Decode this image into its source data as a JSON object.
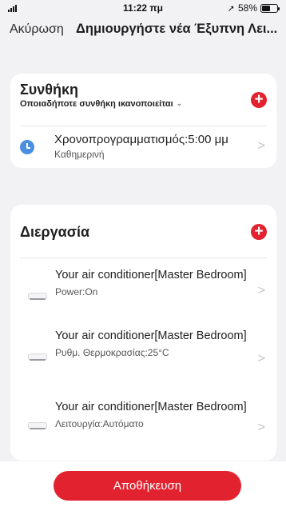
{
  "status_bar": {
    "time": "11:22 πμ",
    "battery_text": "58%",
    "battery_level": 0.58
  },
  "nav": {
    "cancel_label": "Ακύρωση",
    "title": "Δημιουργήστε νέα Έξυπνη Λει..."
  },
  "condition": {
    "title": "Συνθήκη",
    "subtitle": "Οποιαδήποτε συνθήκη ικανοποιείται",
    "items": [
      {
        "icon": "clock-icon",
        "label": "Χρονοπρογραμματισμός:5:00 μμ",
        "sub": "Καθημερινή"
      }
    ]
  },
  "task": {
    "title": "Διεργασία",
    "items": [
      {
        "icon": "air-conditioner-icon",
        "name": "Your air conditioner[Master Bedroom]",
        "value": "Power:On"
      },
      {
        "icon": "air-conditioner-icon",
        "name": "Your air conditioner[Master Bedroom]",
        "value": "Ρυθμ. Θερμοκρασίας:25°C"
      },
      {
        "icon": "air-conditioner-icon",
        "name": "Your air conditioner[Master Bedroom]",
        "value": "Λειτουργία:Αυτόματο"
      }
    ]
  },
  "save_label": "Αποθήκευση",
  "colors": {
    "accent": "#e3222f",
    "clock_icon": "#4a8fe0",
    "background": "#f2f2f5"
  }
}
